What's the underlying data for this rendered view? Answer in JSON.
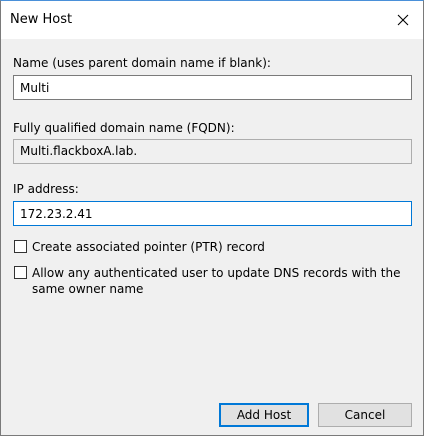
{
  "dialog": {
    "title": "New Host"
  },
  "name": {
    "label": "Name (uses parent domain name if blank):",
    "value": "Multi"
  },
  "fqdn": {
    "label": "Fully qualified domain name (FQDN):",
    "value": "Multi.flackboxA.lab."
  },
  "ip": {
    "label": "IP address:",
    "value": "172.23.2.41"
  },
  "ptr_checkbox": {
    "label": "Create associated pointer (PTR) record",
    "checked": false
  },
  "auth_checkbox": {
    "label": "Allow any authenticated user to update DNS records with the same owner name",
    "checked": false
  },
  "buttons": {
    "add_host": "Add Host",
    "cancel": "Cancel"
  },
  "icons": {
    "close": "close-icon"
  }
}
